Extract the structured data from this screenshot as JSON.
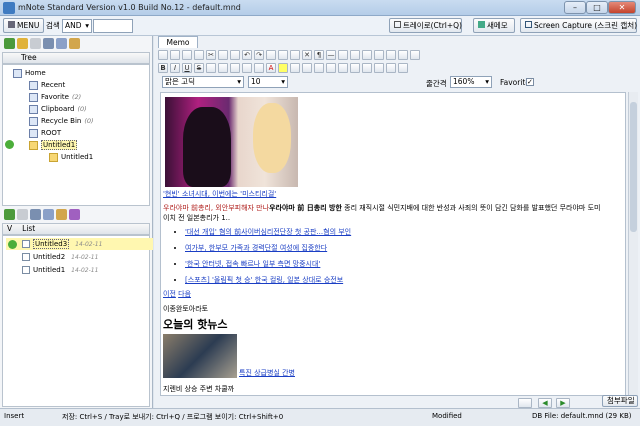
{
  "window": {
    "title": "mNote Standard Version v1.0 Build No.12 - default.mnd",
    "min": "–",
    "max": "□",
    "close": "✕"
  },
  "menubar": {
    "menu_label": "MENU",
    "search_label": "검색",
    "search_mode": "AND",
    "search_value": "",
    "tray_button": "트레이로(Ctrl+Q)",
    "new_memo_button": "새메모",
    "capture_button": "Screen Capture (스크린 캡처)"
  },
  "tree": {
    "header": "Tree",
    "nodes": [
      {
        "label": "Home",
        "count": ""
      },
      {
        "label": "Recent",
        "count": ""
      },
      {
        "label": "Favorite",
        "count": "(2)"
      },
      {
        "label": "Clipboard",
        "count": "(0)"
      },
      {
        "label": "Recycle Bin",
        "count": "(0)"
      },
      {
        "label": "ROOT",
        "count": ""
      },
      {
        "label": "Untitled1",
        "count": ""
      },
      {
        "label": "Untitled1",
        "count": ""
      }
    ]
  },
  "list": {
    "col_v": "V",
    "col_list": "List",
    "rows": [
      {
        "title": "Untitled3",
        "date": "14-02-11",
        "selected": true
      },
      {
        "title": "Untitled2",
        "date": "14-02-11",
        "selected": false
      },
      {
        "title": "Untitled1",
        "date": "14-02-11",
        "selected": false
      }
    ]
  },
  "editor": {
    "tab": "Memo",
    "font_name": "맑은 고딕",
    "font_size": "10",
    "line_spacing_label": "줄간격",
    "line_spacing": "160%",
    "favorite_label": "Favorite",
    "favorite_checked": "✓",
    "content": {
      "caption": "'현빈' 소녀시대, 이번에는 '미스티리걸'",
      "para_start": "우라야마 前총리, 외안부피해자 만나",
      "para_bold": "우라야마 前 日총리 방한",
      "para_end": " 종리 재직시절 식민지배에 대한 반성과 사죄의 뜻이 담긴 담화를 발표했던 무라야마 도미이치 전 일본총리가 1..",
      "bullets": [
        "'대선 개입' 혐의 前사이버심리전단장 첫 공판...혐의 부인",
        "여가부, 한부모 가족과 경력단절 여성에 집중한다",
        "'한국 안터넷, 접속 빠르나 일부 측면 망중시대'",
        "[스포츠] '올림픽 첫 승' 한국 컬링, 일본 상대로 승전보"
      ],
      "prev": "이전",
      "next": "다음",
      "source": "이종완토아라토",
      "hot_news": "오늘의 핫뉴스",
      "special": "특진 상급병실 간병",
      "last_line": "지렌비 상승 주변 차쿨까"
    }
  },
  "bottom": {
    "attach_button": "첨부파일"
  },
  "status": {
    "mode": "Insert",
    "shortcuts": "저장: Ctrl+S / Tray로 보내기: Ctrl+Q / 프로그램 보이기: Ctrl+Shift+0",
    "modified": "Modified",
    "db_file": "DB File: default.mnd (29 KB)"
  },
  "colors": {
    "accent": "#3f7bc1",
    "selection": "#fff7b0",
    "link": "#1a3ec4"
  }
}
